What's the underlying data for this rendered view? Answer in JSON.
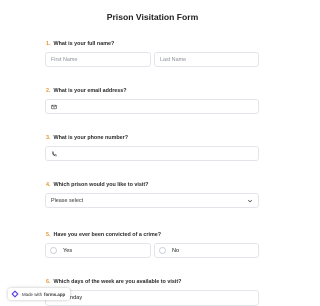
{
  "page": {
    "title": "Prison Visitation Form"
  },
  "questions": [
    {
      "num": "1.",
      "label": "What is your full name?",
      "first_placeholder": "First Name",
      "last_placeholder": "Last Name"
    },
    {
      "num": "2.",
      "label": "What is your email address?",
      "icon": "envelope-icon"
    },
    {
      "num": "3.",
      "label": "What is your phone number?",
      "icon": "phone-icon"
    },
    {
      "num": "4.",
      "label": "Which prison would you like to visit?",
      "selected": "Please select"
    },
    {
      "num": "5.",
      "label": "Have you ever been convicted of a crime?",
      "options": [
        "Yes",
        "No"
      ]
    },
    {
      "num": "6.",
      "label": "Which days of the week are you available to visit?",
      "partial_option": "nday"
    }
  ],
  "badge": {
    "text": "Made with",
    "brand": "forms.app"
  },
  "colors": {
    "accent": "#e8942e",
    "border": "#e3e5ea"
  }
}
